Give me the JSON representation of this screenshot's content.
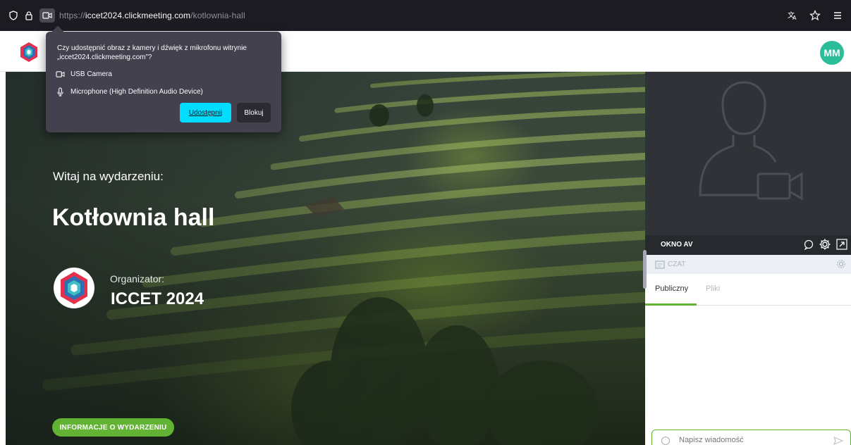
{
  "browser": {
    "url_prefix": "https://",
    "url_host": "iccet2024.clickmeeting.com",
    "url_path": "/kotlownia-hall"
  },
  "permission_popup": {
    "question": "Czy udostępnić obraz z kamery i dźwięk z mikrofonu witrynie „iccet2024.clickmeeting.com”?",
    "camera_label": "USB Camera",
    "microphone_label": "Microphone (High Definition Audio Device)",
    "share_button": "Udostępnij",
    "block_button": "Blokuj"
  },
  "header": {
    "avatar_initials": "MM"
  },
  "hero": {
    "welcome_text": "Witaj na wydarzeniu:",
    "event_title": "Kotłownia hall",
    "organizer_label": "Organizator:",
    "organizer_name": "ICCET 2024",
    "info_button": "INFORMACJE O WYDARZENIU"
  },
  "av_panel": {
    "label": "OKNO AV"
  },
  "chat": {
    "header_label": "CZAT",
    "tabs": [
      {
        "label": "Publiczny",
        "active": true
      },
      {
        "label": "Pliki",
        "active": false
      }
    ],
    "input_placeholder": "Napisz wiadomość"
  },
  "colors": {
    "accent_green": "#62b233",
    "share_blue": "#00ddff",
    "avatar_teal": "#2bbd9a"
  }
}
